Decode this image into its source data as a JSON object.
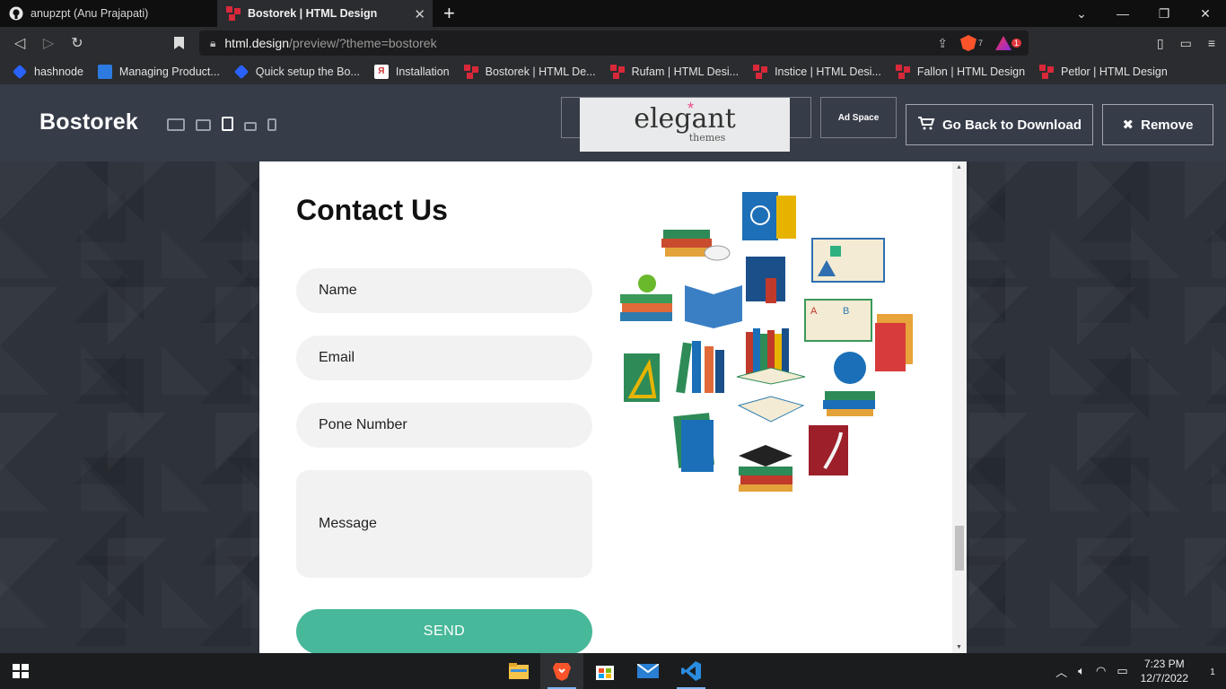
{
  "browser": {
    "tabs": [
      {
        "title": "anupzpt (Anu Prajapati)",
        "icon": "github-icon",
        "active": false
      },
      {
        "title": "Bostorek | HTML Design",
        "icon": "html-design-icon",
        "active": true
      }
    ],
    "new_tab": "+",
    "url": {
      "host": "html.design",
      "path": "/preview/?theme=bostorek"
    },
    "brave_shield_count": "7",
    "rewards_count": "1",
    "bookmarks": [
      {
        "label": "hashnode",
        "icon": "hashnode-icon"
      },
      {
        "label": "Managing Product...",
        "icon": "product-icon"
      },
      {
        "label": "Quick setup the Bo...",
        "icon": "hashnode-icon"
      },
      {
        "label": "Installation",
        "icon": "installation-icon"
      },
      {
        "label": "Bostorek | HTML De...",
        "icon": "html-design-icon"
      },
      {
        "label": "Rufam | HTML Desi...",
        "icon": "html-design-icon"
      },
      {
        "label": "Instice | HTML Desi...",
        "icon": "html-design-icon"
      },
      {
        "label": "Fallon | HTML Design",
        "icon": "html-design-icon"
      },
      {
        "label": "Petlor | HTML Design",
        "icon": "html-design-icon"
      }
    ]
  },
  "site_header": {
    "brand": "Bostorek",
    "ad_logo": {
      "word": "elegant",
      "sub": "themes"
    },
    "ad_space": "Ad Space",
    "download_button": "Go Back to Download",
    "remove_button": "Remove"
  },
  "contact": {
    "title": "Contact Us",
    "name_placeholder": "Name",
    "email_placeholder": "Email",
    "phone_placeholder": "Pone Number",
    "message_placeholder": "Message",
    "send_label": "SEND"
  },
  "taskbar": {
    "apps": [
      "file-explorer-icon",
      "brave-icon",
      "store-icon",
      "mail-icon",
      "vscode-icon"
    ],
    "time": "7:23 PM",
    "date": "12/7/2022",
    "notification_count": "1"
  },
  "colors": {
    "site_header_bg": "#363c48",
    "send_button": "#48b89a",
    "field_bg": "#f2f2f2"
  }
}
